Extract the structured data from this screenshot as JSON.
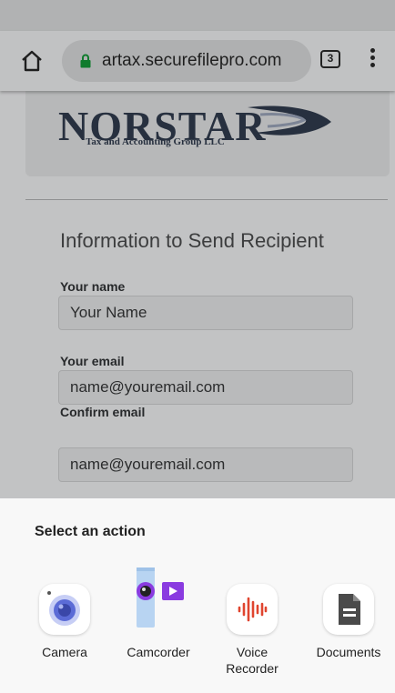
{
  "browser": {
    "url": "artax.securefilepro.com",
    "tab_count": "3"
  },
  "page": {
    "logo_name": "NORSTAR",
    "logo_subtitle": "Tax and Accounting Group LLC",
    "form_title": "Information to Send Recipient",
    "fields": [
      {
        "label": "Your name",
        "value": "Your Name"
      },
      {
        "label": "Your email",
        "value": "name@youremail.com"
      },
      {
        "label": "Confirm email",
        "value": "name@youremail.com"
      }
    ]
  },
  "sheet": {
    "title": "Select an action",
    "actions": [
      {
        "label": "Camera",
        "icon": "camera-icon"
      },
      {
        "label": "Camcorder",
        "icon": "camcorder-icon"
      },
      {
        "label": "Voice Recorder",
        "icon": "voice-recorder-icon"
      },
      {
        "label": "Documents",
        "icon": "documents-icon"
      }
    ]
  },
  "colors": {
    "camera_accent": "#5b6bd6",
    "recorder_accent": "#e0452f",
    "camcorder_accent": "#8a3be0"
  }
}
